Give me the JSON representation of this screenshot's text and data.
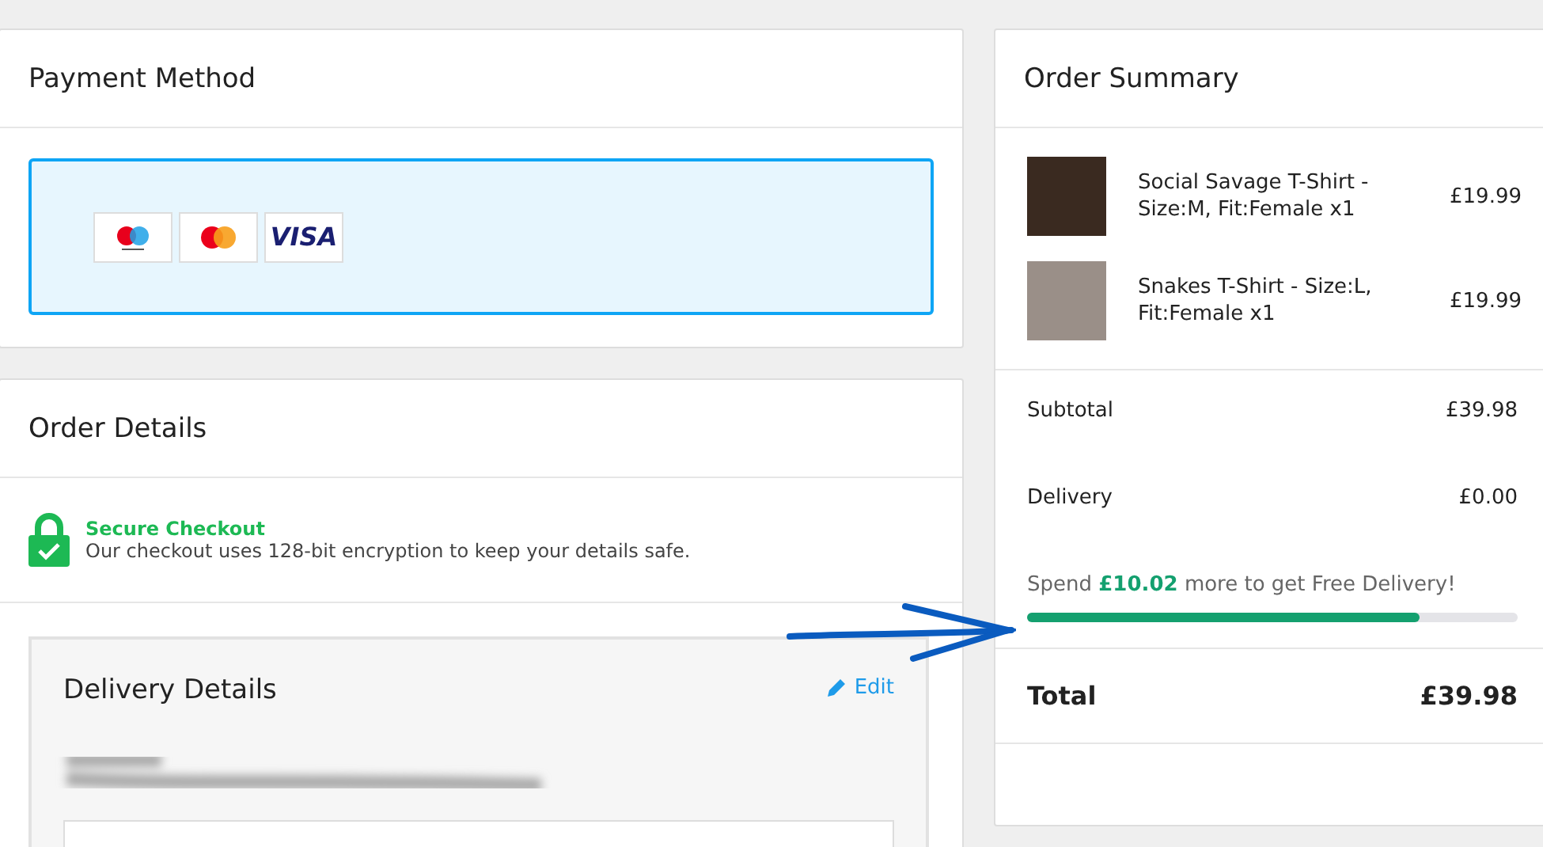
{
  "payment_method": {
    "title": "Payment Method",
    "cards": [
      {
        "kind": "maestro"
      },
      {
        "kind": "mastercard"
      },
      {
        "kind": "visa",
        "label": "VISA"
      }
    ]
  },
  "order_details": {
    "title": "Order Details",
    "secure": {
      "title": "Secure Checkout",
      "text": "Our checkout uses 128-bit encryption to keep your details safe."
    },
    "delivery": {
      "title": "Delivery Details",
      "edit": "Edit"
    }
  },
  "order_summary": {
    "title": "Order Summary",
    "items": [
      {
        "name": "Social Savage T-Shirt - Size:M, Fit:Female x1",
        "price": "£19.99"
      },
      {
        "name": "Snakes T-Shirt - Size:L, Fit:Female x1",
        "price": "£19.99"
      }
    ],
    "subtotal": {
      "label": "Subtotal",
      "value": "£39.98"
    },
    "delivery": {
      "label": "Delivery",
      "value": "£0.00"
    },
    "free_delivery": {
      "message": "Spend **£10.02** more to get Free Delivery!",
      "level": 0.8
    },
    "total": {
      "label": "Total",
      "value": "£39.98"
    }
  }
}
